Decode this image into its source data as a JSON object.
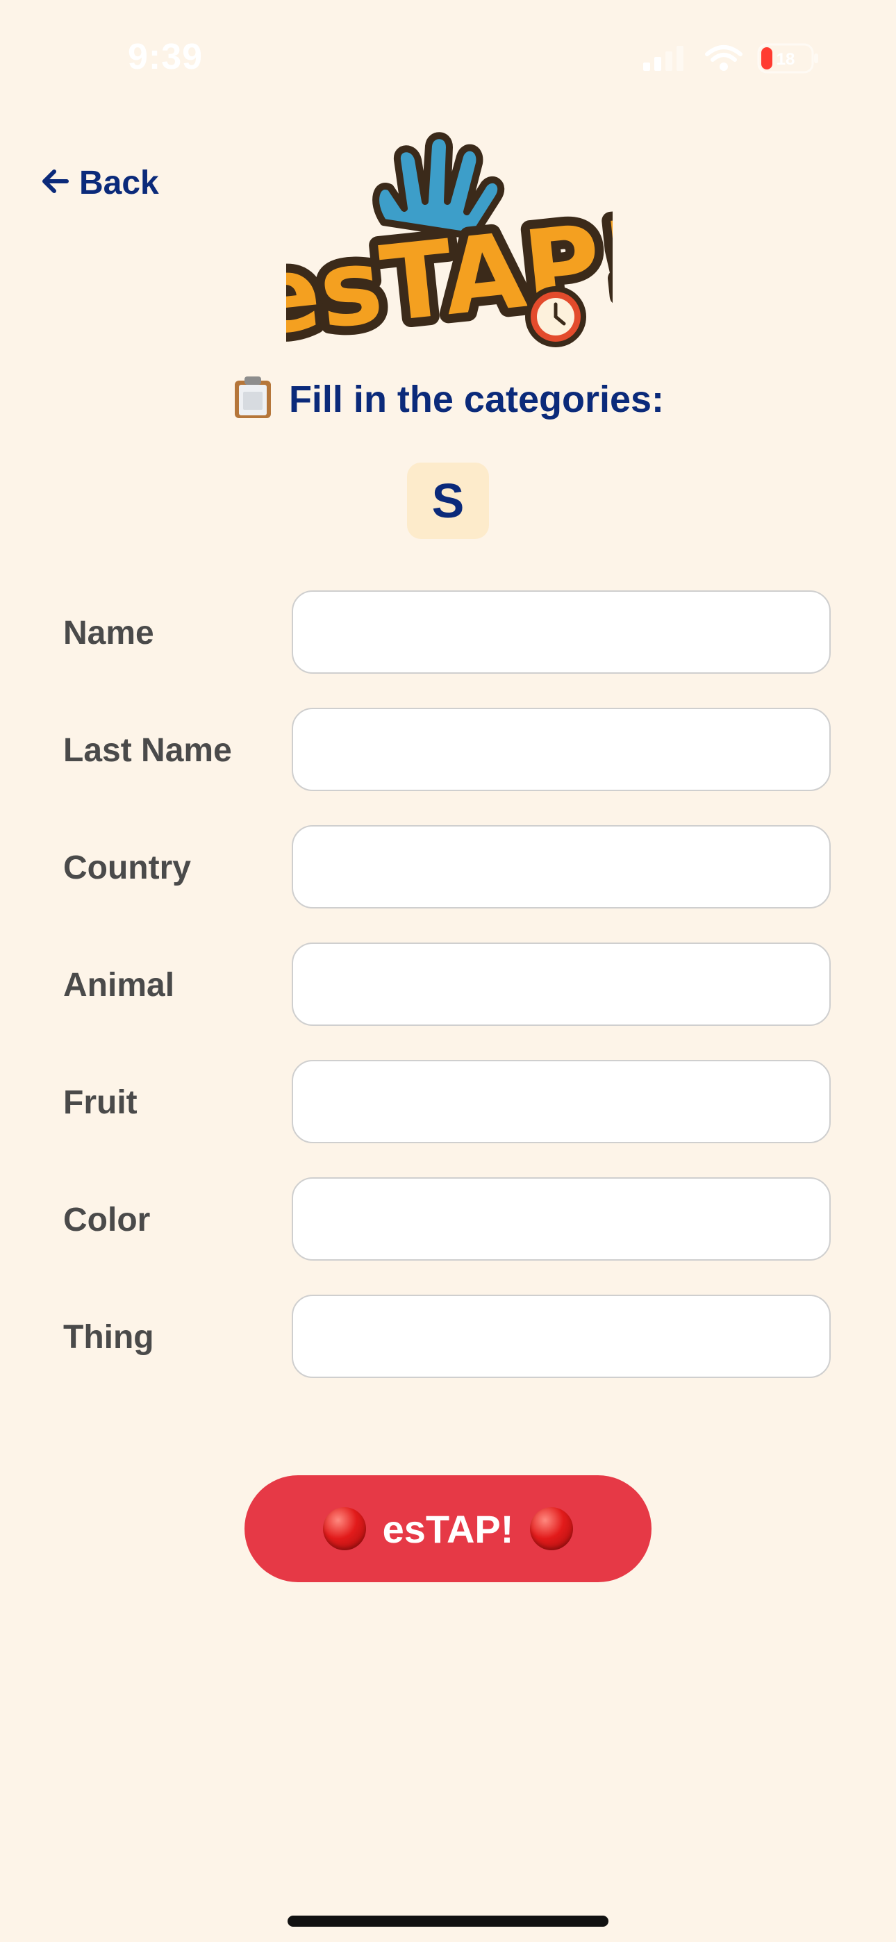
{
  "status_bar": {
    "time": "9:39",
    "battery_level": "18"
  },
  "nav": {
    "back_label": "Back",
    "back_arrow": "←"
  },
  "logo": {
    "text": "esTAP!"
  },
  "instruction": {
    "icon": "clipboard-icon",
    "text": "Fill in the categories:"
  },
  "letter": "S",
  "fields": [
    {
      "label": "Name",
      "value": "",
      "placeholder": ""
    },
    {
      "label": "Last Name",
      "value": "",
      "placeholder": ""
    },
    {
      "label": "Country",
      "value": "",
      "placeholder": ""
    },
    {
      "label": "Animal",
      "value": "",
      "placeholder": ""
    },
    {
      "label": "Fruit",
      "value": "",
      "placeholder": ""
    },
    {
      "label": "Color",
      "value": "",
      "placeholder": ""
    },
    {
      "label": "Thing",
      "value": "",
      "placeholder": ""
    }
  ],
  "submit": {
    "label": "esTAP!",
    "icon": "red-circle-icon"
  },
  "colors": {
    "background": "#fdf4e8",
    "accent_blue": "#0b2a7a",
    "submit_red": "#e63946",
    "letter_badge": "#fdebcb"
  }
}
